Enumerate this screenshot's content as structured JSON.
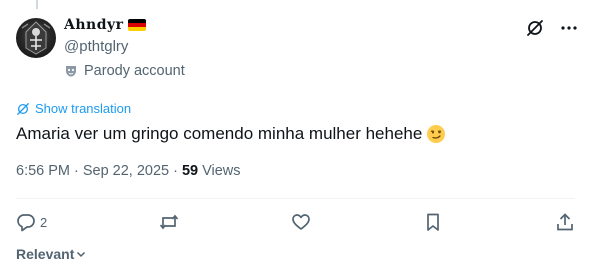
{
  "post": {
    "display_name": "Ahndyr",
    "flag": {
      "name": "germany-flag",
      "colors": [
        "#000000",
        "#dd0000",
        "#ffce00"
      ]
    },
    "handle": "@pthtglry",
    "parody_label": "Parody account",
    "show_translation": "Show translation",
    "text": "Amaria ver um gringo comendo minha mulher hehehe",
    "emoji": "smirking-face-emoji",
    "time": "6:56 PM",
    "date": "Sep 22, 2025",
    "separator": "·",
    "views_count": "59",
    "views_label": "Views"
  },
  "actions": {
    "reply_count": "2",
    "icons": [
      "reply-icon",
      "repost-icon",
      "like-icon",
      "bookmark-icon",
      "share-icon"
    ]
  },
  "sort": {
    "label": "Relevant"
  },
  "colors": {
    "accent": "#1d9bf0",
    "text": "#0f1419",
    "secondary": "#536471",
    "divider": "#eff3f4"
  }
}
